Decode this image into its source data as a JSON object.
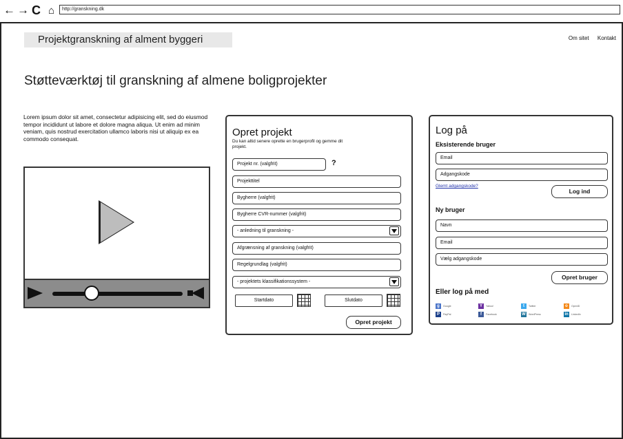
{
  "browser": {
    "url": "http://granskning.dk",
    "back_icon": "←",
    "forward_icon": "→",
    "reload_icon": "C",
    "home_icon": "⌂"
  },
  "header": {
    "site_title": "Projektgranskning af alment byggeri",
    "nav": [
      "Om sitet",
      "Kontakt"
    ]
  },
  "page": {
    "headline": "Støtteværktøj til granskning af almene boligprojekter",
    "intro": "Lorem ipsum dolor sit amet, consectetur adipisicing elit, sed do eiusmod tempor incididunt ut labore et dolore magna aliqua. Ut enim ad minim veniam, quis nostrud exercitation ullamco laboris nisi ut aliquip ex ea commodo consequat."
  },
  "video": {
    "progress": 0.3
  },
  "create_project": {
    "title": "Opret projekt",
    "subtitle": "Du kan altid senere oprette en brugerprofil og gemme dit projekt.",
    "project_no": "Projekt nr. (valgfrit)",
    "help": "?",
    "project_title": "Projekttitel",
    "developer": "Bygherre (valgfrit)",
    "developer_cvr": "Bygherre CVR-nummer (valgfrit)",
    "reason_select": "- anledning til granskning -",
    "scope": "Afgrænsning af granskning (valgfrit)",
    "regulation": "Regelgrundlag (valgfrit)",
    "classification_select": "- projektets klassifikationssystem -",
    "start_date": "Startdato",
    "end_date": "Slutdato",
    "submit": "Opret projekt"
  },
  "login": {
    "title": "Log på",
    "existing_heading": "Eksisterende bruger",
    "email": "Email",
    "password": "Adgangskode",
    "forgot": "Glemt adgangskode?",
    "login_button": "Log ind",
    "new_heading": "Ny bruger",
    "name": "Navn",
    "new_email": "Email",
    "new_password": "Vælg adgangskode",
    "create_button": "Opret bruger",
    "social_heading": "Eller log på med",
    "providers": [
      {
        "label": "Google",
        "color": "#4a74c9",
        "glyph": "g"
      },
      {
        "label": "Yahoo!",
        "color": "#6b2fa0",
        "glyph": "Y"
      },
      {
        "label": "Twitter",
        "color": "#3ba9ee",
        "glyph": "t"
      },
      {
        "label": "OpenID",
        "color": "#f48a1c",
        "glyph": "o"
      },
      {
        "label": "PayPal",
        "color": "#1b3f8a",
        "glyph": "P"
      },
      {
        "label": "Facebook",
        "color": "#3b5998",
        "glyph": "f"
      },
      {
        "label": "WordPress",
        "color": "#21759b",
        "glyph": "W"
      },
      {
        "label": "LinkedIn",
        "color": "#0e76a8",
        "glyph": "in"
      }
    ]
  }
}
